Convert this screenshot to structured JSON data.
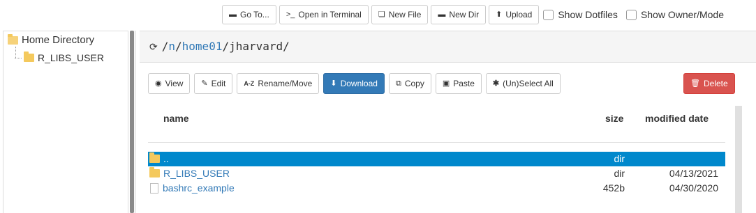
{
  "toolbar": {
    "goto_label": "Go To...",
    "terminal_label": "Open in Terminal",
    "newfile_label": "New File",
    "newdir_label": "New Dir",
    "upload_label": "Upload",
    "show_dotfiles_label": "Show Dotfiles",
    "show_owner_label": "Show Owner/Mode",
    "show_dotfiles_checked": false,
    "show_owner_checked": false
  },
  "tree": {
    "root_label": "Home Directory",
    "children": [
      {
        "label": "R_LIBS_USER"
      }
    ]
  },
  "path": {
    "reload_icon": "refresh-icon",
    "sep": "/",
    "parts": [
      "n",
      "home01"
    ],
    "current": "jharvard/"
  },
  "actions": {
    "view_label": "View",
    "edit_label": "Edit",
    "rename_label": "Rename/Move",
    "download_label": "Download",
    "copy_label": "Copy",
    "paste_label": "Paste",
    "select_all_label": "(Un)Select All",
    "delete_label": "Delete"
  },
  "table": {
    "headers": {
      "name": "name",
      "size": "size",
      "modified": "modified date"
    },
    "rows": [
      {
        "name": "..",
        "size": "dir",
        "modified": "",
        "type": "folder",
        "selected": true
      },
      {
        "name": "R_LIBS_USER",
        "size": "dir",
        "modified": "04/13/2021",
        "type": "folder",
        "selected": false
      },
      {
        "name": "bashrc_example",
        "size": "452b",
        "modified": "04/30/2020",
        "type": "file",
        "selected": false
      }
    ]
  },
  "colors": {
    "primary": "#337ab7",
    "danger": "#d9534f",
    "selected_row": "#0088cc",
    "folder": "#f4c95d"
  }
}
